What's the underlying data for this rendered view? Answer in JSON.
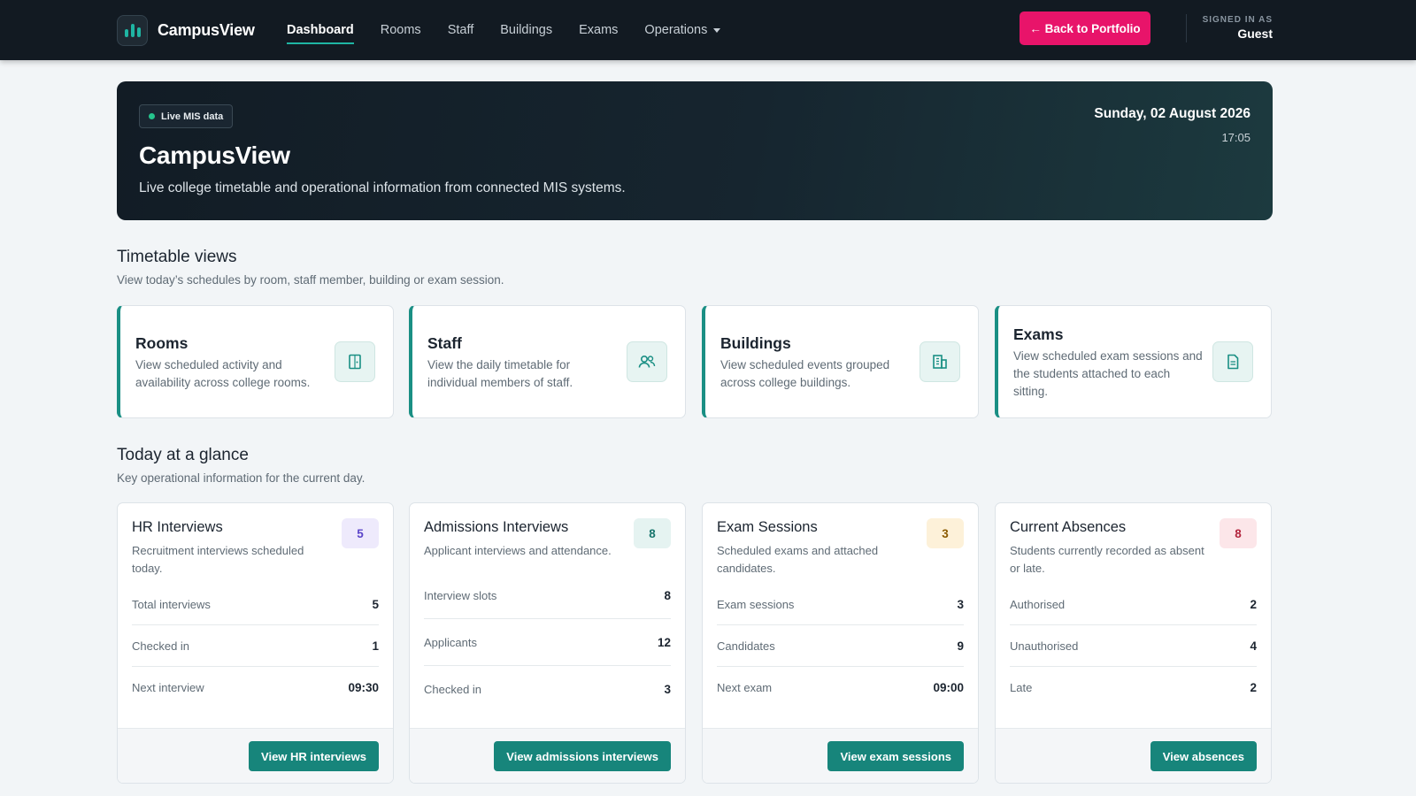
{
  "nav": {
    "brand": "CampusView",
    "brand_icon": "bar-chart-icon",
    "links": [
      {
        "label": "Dashboard",
        "active": true
      },
      {
        "label": "Rooms"
      },
      {
        "label": "Staff"
      },
      {
        "label": "Buildings"
      },
      {
        "label": "Exams"
      },
      {
        "label": "Operations",
        "dropdown": true
      }
    ],
    "back_button": "← Back to Portfolio",
    "signed_in_label": "SIGNED IN AS",
    "signed_in_user": "Guest"
  },
  "hero": {
    "badge": "Live MIS data",
    "title": "CampusView",
    "subtitle": "Live college timetable and operational information from connected MIS systems.",
    "date": "Sunday, 02 August 2026",
    "time": "17:05"
  },
  "timetable": {
    "title": "Timetable views",
    "subtitle": "View today’s schedules by room, staff member, building or exam session.",
    "cards": [
      {
        "title": "Rooms",
        "desc": "View scheduled activity and availability across college rooms.",
        "icon": "door-icon"
      },
      {
        "title": "Staff",
        "desc": "View the daily timetable for individual members of staff.",
        "icon": "people-icon"
      },
      {
        "title": "Buildings",
        "desc": "View scheduled events grouped across college buildings.",
        "icon": "building-icon"
      },
      {
        "title": "Exams",
        "desc": "View scheduled exam sessions and the students attached to each sitting.",
        "icon": "document-icon"
      }
    ]
  },
  "glance": {
    "title": "Today at a glance",
    "subtitle": "Key operational information for the current day.",
    "cards": [
      {
        "title": "HR Interviews",
        "desc": "Recruitment interviews scheduled today.",
        "count": "5",
        "badge_bg": "#eeeafc",
        "badge_fg": "#5b45c9",
        "rows": [
          {
            "label": "Total interviews",
            "value": "5"
          },
          {
            "label": "Checked in",
            "value": "1"
          },
          {
            "label": "Next interview",
            "value": "09:30"
          }
        ],
        "button": "View HR interviews"
      },
      {
        "title": "Admissions Interviews",
        "desc": "Applicant interviews and attendance.",
        "count": "8",
        "badge_bg": "#e5f3f1",
        "badge_fg": "#17756c",
        "rows": [
          {
            "label": "Interview slots",
            "value": "8"
          },
          {
            "label": "Applicants",
            "value": "12"
          },
          {
            "label": "Checked in",
            "value": "3"
          }
        ],
        "button": "View admissions interviews"
      },
      {
        "title": "Exam Sessions",
        "desc": "Scheduled exams and attached candidates.",
        "count": "3",
        "badge_bg": "#fdf1d9",
        "badge_fg": "#8a5a00",
        "rows": [
          {
            "label": "Exam sessions",
            "value": "3"
          },
          {
            "label": "Candidates",
            "value": "9"
          },
          {
            "label": "Next exam",
            "value": "09:00"
          }
        ],
        "button": "View exam sessions"
      },
      {
        "title": "Current Absences",
        "desc": "Students currently recorded as absent or late.",
        "count": "8",
        "badge_bg": "#fce6e9",
        "badge_fg": "#b3263e",
        "rows": [
          {
            "label": "Authorised",
            "value": "2"
          },
          {
            "label": "Unauthorised",
            "value": "4"
          },
          {
            "label": "Late",
            "value": "2"
          }
        ],
        "button": "View absences"
      }
    ]
  },
  "colors": {
    "accent": "#1fb5a3",
    "button_teal": "#17857b",
    "back_button_pink": "#e8146a",
    "navbar": "#121a22"
  }
}
